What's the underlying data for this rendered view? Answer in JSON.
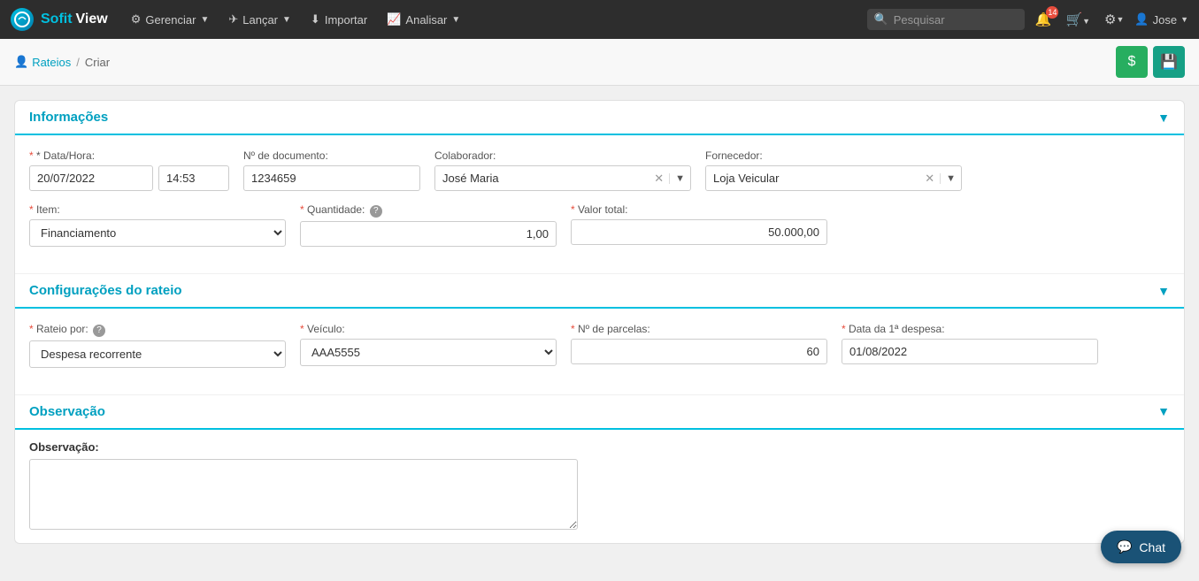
{
  "brand": {
    "sofit": "Sofit",
    "view": "View",
    "logo_text": "S"
  },
  "navbar": {
    "items": [
      {
        "id": "gerenciar",
        "label": "Gerenciar",
        "icon": "⚙",
        "has_arrow": true
      },
      {
        "id": "lancar",
        "label": "Lançar",
        "icon": "✈",
        "has_arrow": true
      },
      {
        "id": "importar",
        "label": "Importar",
        "icon": "⬇",
        "has_arrow": false
      },
      {
        "id": "analisar",
        "label": "Analisar",
        "icon": "📈",
        "has_arrow": true
      }
    ],
    "search_placeholder": "Pesquisar",
    "notification_count": "14",
    "user_name": "Jose"
  },
  "breadcrumb": {
    "parent_label": "Rateios",
    "parent_icon": "👤",
    "separator": "/",
    "current": "Criar"
  },
  "sections": {
    "informacoes": {
      "title": "Informações",
      "fields": {
        "data_hora_label": "* Data/Hora:",
        "data_value": "20/07/2022",
        "hora_value": "14:53",
        "nro_documento_label": "Nº de documento:",
        "nro_documento_value": "1234659",
        "colaborador_label": "Colaborador:",
        "colaborador_value": "José Maria",
        "fornecedor_label": "Fornecedor:",
        "fornecedor_value": "Loja Veicular",
        "item_label": "* Item:",
        "item_value": "Financiamento",
        "quantidade_label": "* Quantidade:",
        "quantidade_value": "1,00",
        "valor_total_label": "* Valor total:",
        "valor_total_value": "50.000,00"
      }
    },
    "configuracoes": {
      "title": "Configurações do rateio",
      "fields": {
        "rateio_por_label": "* Rateio por:",
        "rateio_por_value": "Despesa recorrente",
        "veiculo_label": "* Veículo:",
        "veiculo_value": "AAA5555",
        "nro_parcelas_label": "* Nº de parcelas:",
        "nro_parcelas_value": "60",
        "data_primeira_label": "* Data da 1ª despesa:",
        "data_primeira_value": "01/08/2022"
      }
    },
    "observacao": {
      "title": "Observação",
      "obs_label": "Observação:",
      "obs_value": ""
    }
  },
  "chat": {
    "label": "Chat",
    "icon": "💬"
  },
  "toolbar": {
    "btn_dollar": "$",
    "btn_save": "💾"
  }
}
